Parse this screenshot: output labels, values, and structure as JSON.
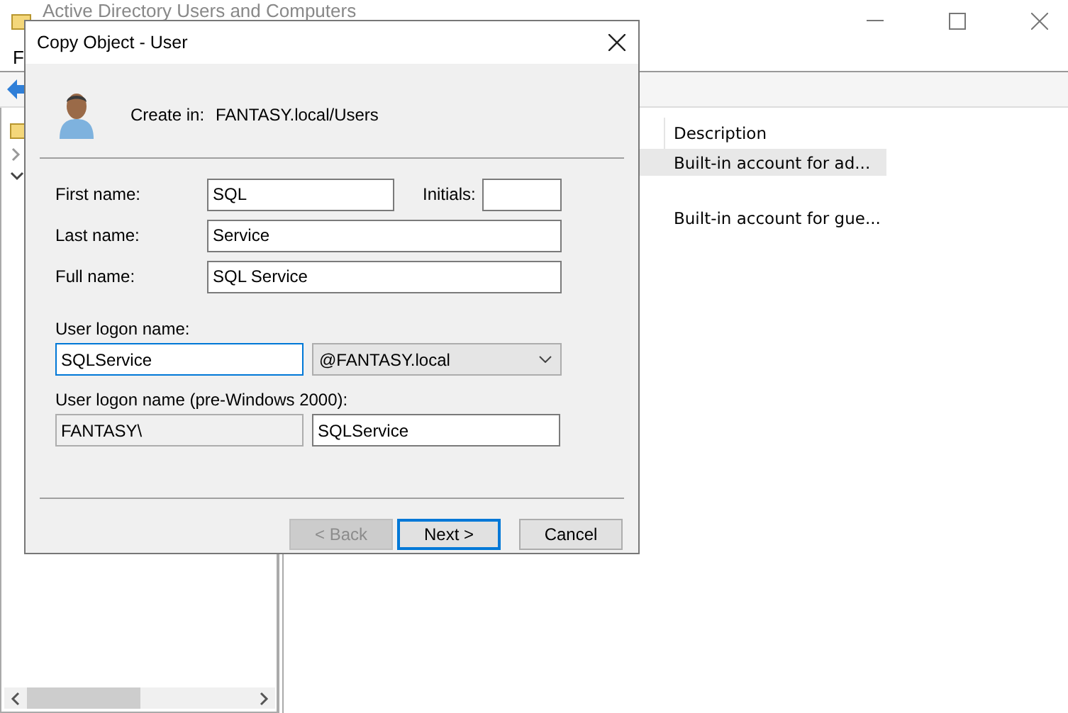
{
  "window": {
    "title": "Active Directory Users and Computers",
    "menu": [
      "F"
    ]
  },
  "list": {
    "columns": [
      "Description"
    ],
    "rows": [
      {
        "description": "Built-in account for ad...",
        "selected": true
      },
      {
        "description": "Built-in account for gue...",
        "selected": false
      }
    ]
  },
  "dialog": {
    "title": "Copy Object - User",
    "create_in_label": "Create in:",
    "create_in_path": "FANTASY.local/Users",
    "first_name": {
      "label": "First name:",
      "value": "SQL"
    },
    "initials": {
      "label": "Initials:"
    },
    "last_name": {
      "label": "Last name:",
      "value": "Service"
    },
    "full_name": {
      "label": "Full name:",
      "value": "SQL Service"
    },
    "logon": {
      "label": "User logon name:",
      "value": "SQLService",
      "focused": true,
      "domain": "@FANTASY.local"
    },
    "pre2000": {
      "label": "User logon name (pre-Windows 2000):",
      "domain": "FANTASY\\",
      "value": "SQLService"
    },
    "buttons": [
      {
        "label": "< Back",
        "disabled": true,
        "default": false
      },
      {
        "label": "Next >",
        "disabled": false,
        "default": true
      },
      {
        "label": "Cancel",
        "disabled": false,
        "default": false
      }
    ]
  }
}
